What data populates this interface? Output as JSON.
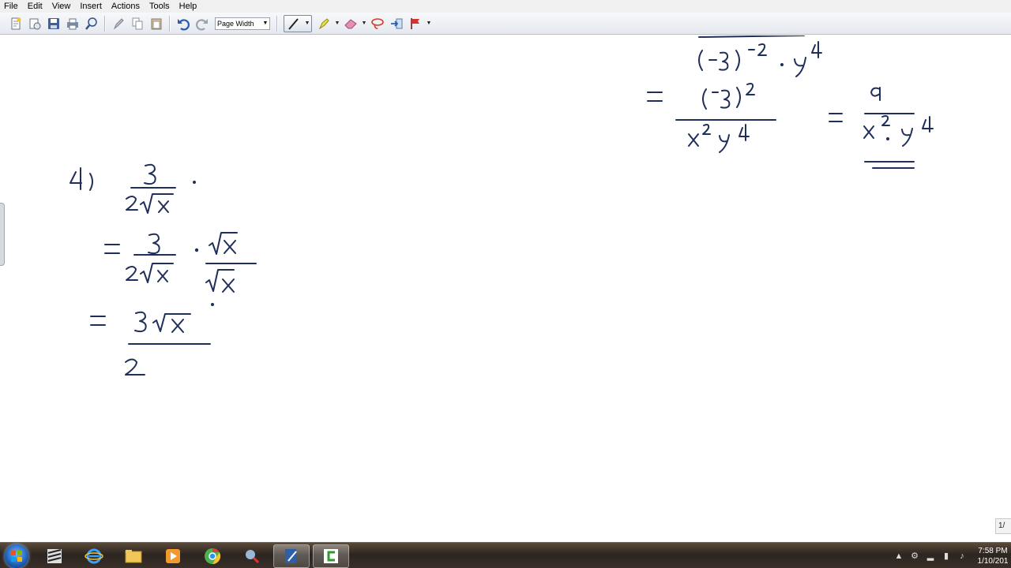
{
  "menu": {
    "items": [
      "File",
      "Edit",
      "View",
      "Insert",
      "Actions",
      "Tools",
      "Help"
    ]
  },
  "toolbar": {
    "zoom_value": "Page Width",
    "icons": [
      "new-page-icon",
      "open-icon",
      "save-icon",
      "print-icon",
      "search-icon",
      "pen-tool-icon",
      "copy-icon",
      "paste-icon",
      "undo-icon",
      "redo-icon",
      "pen-icon",
      "highlighter-icon",
      "eraser-icon",
      "lasso-icon",
      "insert-space-icon",
      "flag-icon"
    ]
  },
  "page_indicator": "1/",
  "tray": {
    "time": "7:58 PM",
    "date": "1/10/201"
  },
  "colors": {
    "ink": "#1f2f5a",
    "menubar": "#f0f0f0",
    "taskbar": "#2c2520"
  }
}
